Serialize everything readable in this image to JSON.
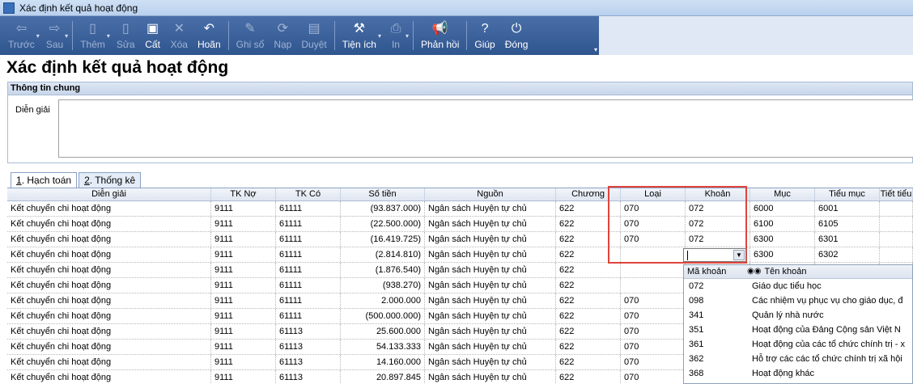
{
  "window": {
    "title": "Xác định kết quả hoạt động"
  },
  "toolbar": {
    "buttons": [
      {
        "label": "Trước",
        "icon": "arrow-left-icon",
        "glyph": "⇦",
        "enabled": false
      },
      {
        "label": "Sau",
        "icon": "arrow-right-icon",
        "glyph": "⇨",
        "enabled": false
      },
      {
        "label": "Thêm",
        "icon": "add-document-icon",
        "glyph": "▯",
        "enabled": false
      },
      {
        "label": "Sửa",
        "icon": "edit-document-icon",
        "glyph": "▯",
        "enabled": false
      },
      {
        "label": "Cất",
        "icon": "save-icon",
        "glyph": "▣",
        "enabled": true
      },
      {
        "label": "Xóa",
        "icon": "delete-icon",
        "glyph": "✕",
        "enabled": false
      },
      {
        "label": "Hoãn",
        "icon": "undo-icon",
        "glyph": "↶",
        "enabled": true
      },
      {
        "label": "Ghi sổ",
        "icon": "post-pencil-icon",
        "glyph": "✎",
        "enabled": false
      },
      {
        "label": "Nạp",
        "icon": "reload-icon",
        "glyph": "⟳",
        "enabled": false
      },
      {
        "label": "Duyệt",
        "icon": "approve-icon",
        "glyph": "▤",
        "enabled": false
      },
      {
        "label": "Tiện ích",
        "icon": "tools-icon",
        "glyph": "⚒",
        "enabled": true
      },
      {
        "label": "In",
        "icon": "print-icon",
        "glyph": "⎙",
        "enabled": false
      },
      {
        "label": "Phản hồi",
        "icon": "feedback-megaphone-icon",
        "glyph": "📢",
        "enabled": true
      },
      {
        "label": "Giúp",
        "icon": "help-icon",
        "glyph": "?",
        "enabled": true
      },
      {
        "label": "Đóng",
        "icon": "close-power-icon",
        "glyph": "⏻",
        "enabled": true
      }
    ]
  },
  "page": {
    "title": "Xác định kết quả hoạt động"
  },
  "general_info": {
    "section_title": "Thông tin chung",
    "description_label": "Diễn giải",
    "description_value": ""
  },
  "tabs": [
    {
      "key": "1",
      "label": ". Hạch toán",
      "active": true
    },
    {
      "key": "2",
      "label": ". Thống kê",
      "active": false
    }
  ],
  "grid": {
    "columns": [
      "Diễn giải",
      "TK Nợ",
      "TK Có",
      "Số tiền",
      "Nguồn",
      "Chương",
      "Loại",
      "Khoản",
      "Mục",
      "Tiểu mục",
      "Tiết tiểu"
    ],
    "rows": [
      [
        "Kết chuyển chi hoạt động",
        "9111",
        "61111",
        "(93.837.000)",
        "Ngân sách Huyện tự chủ",
        "622",
        "070",
        "072",
        "6000",
        "6001",
        ""
      ],
      [
        "Kết chuyển chi hoạt động",
        "9111",
        "61111",
        "(22.500.000)",
        "Ngân sách Huyện tự chủ",
        "622",
        "070",
        "072",
        "6100",
        "6105",
        ""
      ],
      [
        "Kết chuyển chi hoạt động",
        "9111",
        "61111",
        "(16.419.725)",
        "Ngân sách Huyện tự chủ",
        "622",
        "070",
        "072",
        "6300",
        "6301",
        ""
      ],
      [
        "Kết chuyển chi hoạt động",
        "9111",
        "61111",
        "(2.814.810)",
        "Ngân sách Huyện tự chủ",
        "622",
        "",
        "",
        "6300",
        "6302",
        ""
      ],
      [
        "Kết chuyển chi hoạt động",
        "9111",
        "61111",
        "(1.876.540)",
        "Ngân sách Huyện tự chủ",
        "622",
        "",
        "",
        "",
        "",
        ""
      ],
      [
        "Kết chuyển chi hoạt động",
        "9111",
        "61111",
        "(938.270)",
        "Ngân sách Huyện tự chủ",
        "622",
        "",
        "",
        "",
        "",
        ""
      ],
      [
        "Kết chuyển chi hoạt động",
        "9111",
        "61111",
        "2.000.000",
        "Ngân sách Huyện tự chủ",
        "622",
        "070",
        "",
        "",
        "",
        ""
      ],
      [
        "Kết chuyển chi hoạt động",
        "9111",
        "61111",
        "(500.000.000)",
        "Ngân sách Huyện tự chủ",
        "622",
        "070",
        "",
        "",
        "",
        ""
      ],
      [
        "Kết chuyển chi hoạt động",
        "9111",
        "61113",
        "25.600.000",
        "Ngân sách Huyện tự chủ",
        "622",
        "070",
        "",
        "",
        "",
        ""
      ],
      [
        "Kết chuyển chi hoạt động",
        "9111",
        "61113",
        "54.133.333",
        "Ngân sách Huyện tự chủ",
        "622",
        "070",
        "",
        "",
        "",
        ""
      ],
      [
        "Kết chuyển chi hoạt động",
        "9111",
        "61113",
        "14.160.000",
        "Ngân sách Huyện tự chủ",
        "622",
        "070",
        "",
        "",
        "",
        ""
      ],
      [
        "Kết chuyển chi hoạt động",
        "9111",
        "61113",
        "20.897.845",
        "Ngân sách Huyện tự chủ",
        "622",
        "070",
        "",
        "",
        "",
        ""
      ]
    ]
  },
  "khoan_dropdown": {
    "code_header": "Mã khoản",
    "name_header": "Tên khoản",
    "search_icon": "binoculars-icon",
    "items": [
      {
        "code": "072",
        "name": "Giáo dục tiểu học"
      },
      {
        "code": "098",
        "name": "Các nhiệm vụ phục vụ cho giáo dục, đ"
      },
      {
        "code": "341",
        "name": "Quản lý nhà nước"
      },
      {
        "code": "351",
        "name": "Hoạt động của Đảng Cộng sản Việt N"
      },
      {
        "code": "361",
        "name": "Hoạt động của các tổ chức chính trị - x"
      },
      {
        "code": "362",
        "name": "Hỗ trợ các các tổ chức chính trị xã hội"
      },
      {
        "code": "368",
        "name": "Hoạt động khác"
      }
    ]
  }
}
